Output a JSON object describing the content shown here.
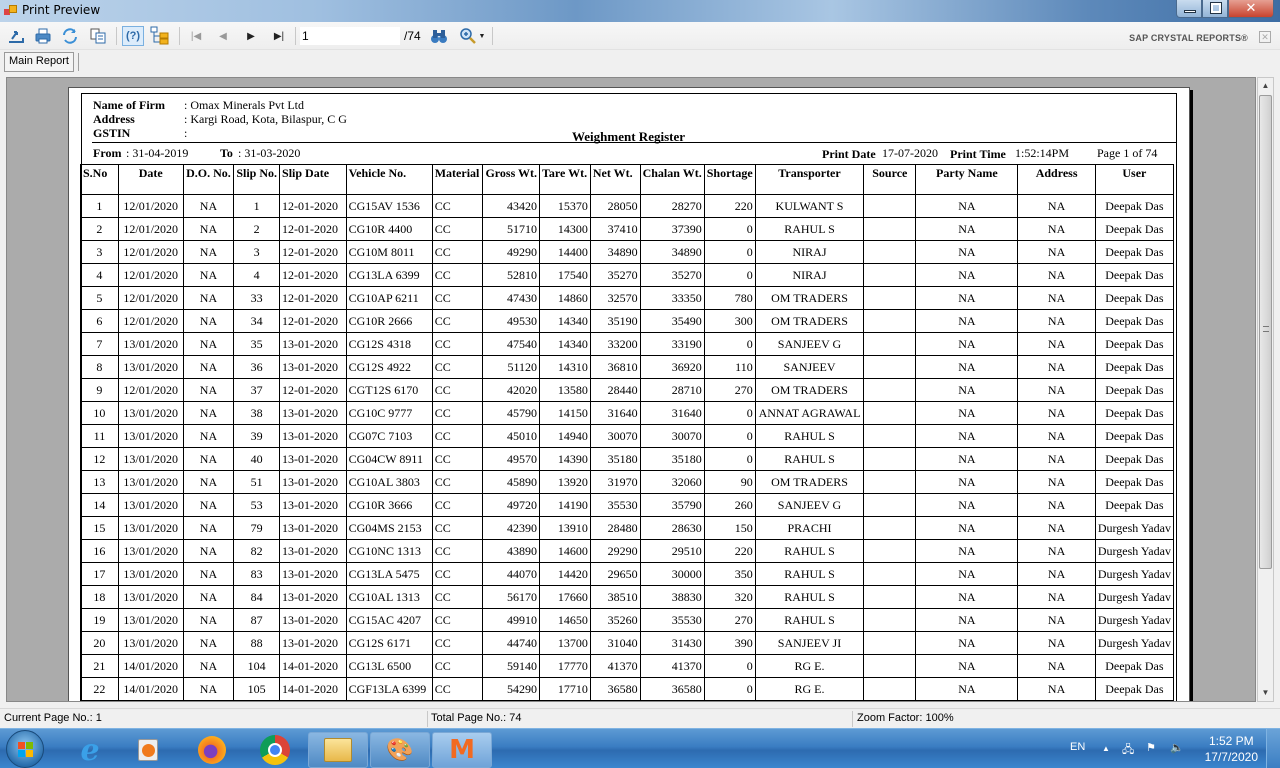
{
  "window": {
    "title": "Print Preview",
    "controls": {
      "minimize": "minimize",
      "restore": "restore",
      "close": "✕"
    }
  },
  "toolbar": {
    "buttons": [
      {
        "name": "export-button",
        "icon": "export-icon",
        "glyph": "⇪"
      },
      {
        "name": "print-button",
        "icon": "printer-icon",
        "glyph": "🖶"
      },
      {
        "name": "refresh-button",
        "icon": "refresh-icon",
        "glyph": "⟳"
      },
      {
        "name": "copy-button",
        "icon": "copy-icon",
        "glyph": "⎘"
      },
      {
        "name": "help-button",
        "icon": "help-icon",
        "glyph": "(?)"
      },
      {
        "name": "group-tree-button",
        "icon": "group-tree-icon",
        "glyph": "⊟"
      },
      {
        "name": "first-page-button",
        "icon": "first-page-icon",
        "glyph": "⏮"
      },
      {
        "name": "previous-page-button",
        "icon": "previous-page-icon",
        "glyph": "◀"
      },
      {
        "name": "next-page-button",
        "icon": "next-page-icon",
        "glyph": "▶"
      },
      {
        "name": "last-page-button",
        "icon": "last-page-icon",
        "glyph": "⏭"
      }
    ],
    "page_input_value": "1",
    "page_total": "/74",
    "find_icon": "binoculars-icon",
    "zoom_icon": "zoom-icon",
    "brand": "SAP CRYSTAL REPORTS®"
  },
  "tabs": [
    {
      "label": "Main Report",
      "active": true
    }
  ],
  "report": {
    "firm_label": "Name of Firm",
    "firm_value": ": Omax Minerals Pvt Ltd",
    "address_label": "Address",
    "address_value": ": Kargi Road, Kota, Bilaspur, C G",
    "gstin_label": "GSTIN",
    "gstin_value": ":",
    "title": "Weighment Register",
    "from_label": "From",
    "from_value": ": 31-04-2019",
    "to_label": "To",
    "to_value": ": 31-03-2020",
    "print_date_label": "Print Date",
    "print_date_value": "17-07-2020",
    "print_time_label": "Print Time",
    "print_time_value": "1:52:14PM",
    "page_info": "Page 1 of 74",
    "columns": [
      "S.No",
      "Date",
      "D.O. No.",
      "Slip No.",
      "Slip Date",
      "Vehicle No.",
      "Material",
      "Gross Wt.",
      "Tare Wt.",
      "Net Wt.",
      "Chalan Wt.",
      "Shortage",
      "Transporter",
      "Source",
      "Party Name",
      "Address",
      "User"
    ],
    "rows": [
      [
        "1",
        "12/01/2020",
        "NA",
        "1",
        "12-01-2020",
        "CG15AV 1536",
        "CC",
        "43420",
        "15370",
        "28050",
        "28270",
        "220",
        "KULWANT S",
        "",
        "NA",
        "NA",
        "Deepak Das"
      ],
      [
        "2",
        "12/01/2020",
        "NA",
        "2",
        "12-01-2020",
        "CG10R 4400",
        "CC",
        "51710",
        "14300",
        "37410",
        "37390",
        "0",
        "RAHUL S",
        "",
        "NA",
        "NA",
        "Deepak Das"
      ],
      [
        "3",
        "12/01/2020",
        "NA",
        "3",
        "12-01-2020",
        "CG10M 8011",
        "CC",
        "49290",
        "14400",
        "34890",
        "34890",
        "0",
        "NIRAJ",
        "",
        "NA",
        "NA",
        "Deepak Das"
      ],
      [
        "4",
        "12/01/2020",
        "NA",
        "4",
        "12-01-2020",
        "CG13LA 6399",
        "CC",
        "52810",
        "17540",
        "35270",
        "35270",
        "0",
        "NIRAJ",
        "",
        "NA",
        "NA",
        "Deepak Das"
      ],
      [
        "5",
        "12/01/2020",
        "NA",
        "33",
        "12-01-2020",
        "CG10AP 6211",
        "CC",
        "47430",
        "14860",
        "32570",
        "33350",
        "780",
        "OM TRADERS",
        "",
        "NA",
        "NA",
        "Deepak Das"
      ],
      [
        "6",
        "12/01/2020",
        "NA",
        "34",
        "12-01-2020",
        "CG10R 2666",
        "CC",
        "49530",
        "14340",
        "35190",
        "35490",
        "300",
        "OM TRADERS",
        "",
        "NA",
        "NA",
        "Deepak Das"
      ],
      [
        "7",
        "13/01/2020",
        "NA",
        "35",
        "13-01-2020",
        "CG12S 4318",
        "CC",
        "47540",
        "14340",
        "33200",
        "33190",
        "0",
        "SANJEEV G",
        "",
        "NA",
        "NA",
        "Deepak Das"
      ],
      [
        "8",
        "13/01/2020",
        "NA",
        "36",
        "13-01-2020",
        "CG12S 4922",
        "CC",
        "51120",
        "14310",
        "36810",
        "36920",
        "110",
        "SANJEEV",
        "",
        "NA",
        "NA",
        "Deepak Das"
      ],
      [
        "9",
        "12/01/2020",
        "NA",
        "37",
        "12-01-2020",
        "CGT12S 6170",
        "CC",
        "42020",
        "13580",
        "28440",
        "28710",
        "270",
        "OM TRADERS",
        "",
        "NA",
        "NA",
        "Deepak Das"
      ],
      [
        "10",
        "13/01/2020",
        "NA",
        "38",
        "13-01-2020",
        "CG10C 9777",
        "CC",
        "45790",
        "14150",
        "31640",
        "31640",
        "0",
        "ANNAT AGRAWAL",
        "",
        "NA",
        "NA",
        "Deepak Das"
      ],
      [
        "11",
        "13/01/2020",
        "NA",
        "39",
        "13-01-2020",
        "CG07C 7103",
        "CC",
        "45010",
        "14940",
        "30070",
        "30070",
        "0",
        "RAHUL S",
        "",
        "NA",
        "NA",
        "Deepak Das"
      ],
      [
        "12",
        "13/01/2020",
        "NA",
        "40",
        "13-01-2020",
        "CG04CW 8911",
        "CC",
        "49570",
        "14390",
        "35180",
        "35180",
        "0",
        "RAHUL S",
        "",
        "NA",
        "NA",
        "Deepak Das"
      ],
      [
        "13",
        "13/01/2020",
        "NA",
        "51",
        "13-01-2020",
        "CG10AL 3803",
        "CC",
        "45890",
        "13920",
        "31970",
        "32060",
        "90",
        "OM TRADERS",
        "",
        "NA",
        "NA",
        "Deepak Das"
      ],
      [
        "14",
        "13/01/2020",
        "NA",
        "53",
        "13-01-2020",
        "CG10R 3666",
        "CC",
        "49720",
        "14190",
        "35530",
        "35790",
        "260",
        "SANJEEV G",
        "",
        "NA",
        "NA",
        "Deepak Das"
      ],
      [
        "15",
        "13/01/2020",
        "NA",
        "79",
        "13-01-2020",
        "CG04MS 2153",
        "CC",
        "42390",
        "13910",
        "28480",
        "28630",
        "150",
        "PRACHI",
        "",
        "NA",
        "NA",
        "Durgesh Yadav"
      ],
      [
        "16",
        "13/01/2020",
        "NA",
        "82",
        "13-01-2020",
        "CG10NC 1313",
        "CC",
        "43890",
        "14600",
        "29290",
        "29510",
        "220",
        "RAHUL S",
        "",
        "NA",
        "NA",
        "Durgesh Yadav"
      ],
      [
        "17",
        "13/01/2020",
        "NA",
        "83",
        "13-01-2020",
        "CG13LA 5475",
        "CC",
        "44070",
        "14420",
        "29650",
        "30000",
        "350",
        "RAHUL S",
        "",
        "NA",
        "NA",
        "Durgesh Yadav"
      ],
      [
        "18",
        "13/01/2020",
        "NA",
        "84",
        "13-01-2020",
        "CG10AL  1313",
        "CC",
        "56170",
        "17660",
        "38510",
        "38830",
        "320",
        "RAHUL S",
        "",
        "NA",
        "NA",
        "Durgesh Yadav"
      ],
      [
        "19",
        "13/01/2020",
        "NA",
        "87",
        "13-01-2020",
        "CG15AC 4207",
        "CC",
        "49910",
        "14650",
        "35260",
        "35530",
        "270",
        "RAHUL S",
        "",
        "NA",
        "NA",
        "Durgesh Yadav"
      ],
      [
        "20",
        "13/01/2020",
        "NA",
        "88",
        "13-01-2020",
        "CG12S 6171",
        "CC",
        "44740",
        "13700",
        "31040",
        "31430",
        "390",
        "SANJEEV JI",
        "",
        "NA",
        "NA",
        "Durgesh Yadav"
      ],
      [
        "21",
        "14/01/2020",
        "NA",
        "104",
        "14-01-2020",
        "CG13L 6500",
        "CC",
        "59140",
        "17770",
        "41370",
        "41370",
        "0",
        "RG E.",
        "",
        "NA",
        "NA",
        "Deepak Das"
      ],
      [
        "22",
        "14/01/2020",
        "NA",
        "105",
        "14-01-2020",
        "CGF13LA 6399",
        "CC",
        "54290",
        "17710",
        "36580",
        "36580",
        "0",
        "RG E.",
        "",
        "NA",
        "NA",
        "Deepak Das"
      ]
    ]
  },
  "statusbar": {
    "current_page": "Current Page No.: 1",
    "total_pages": "Total Page No.: 74",
    "zoom_factor": "Zoom Factor: 100%"
  },
  "taskbar": {
    "apps": [
      {
        "name": "internet-explorer",
        "glyph": "e"
      },
      {
        "name": "media-player",
        "glyph": "▶"
      },
      {
        "name": "firefox",
        "glyph": "●"
      },
      {
        "name": "chrome",
        "glyph": "◉"
      },
      {
        "name": "file-explorer",
        "glyph": "▤"
      },
      {
        "name": "paint",
        "glyph": "🎨"
      },
      {
        "name": "report-app",
        "glyph": "M"
      }
    ],
    "language": "EN",
    "time": "1:52 PM",
    "date": "17/7/2020"
  }
}
